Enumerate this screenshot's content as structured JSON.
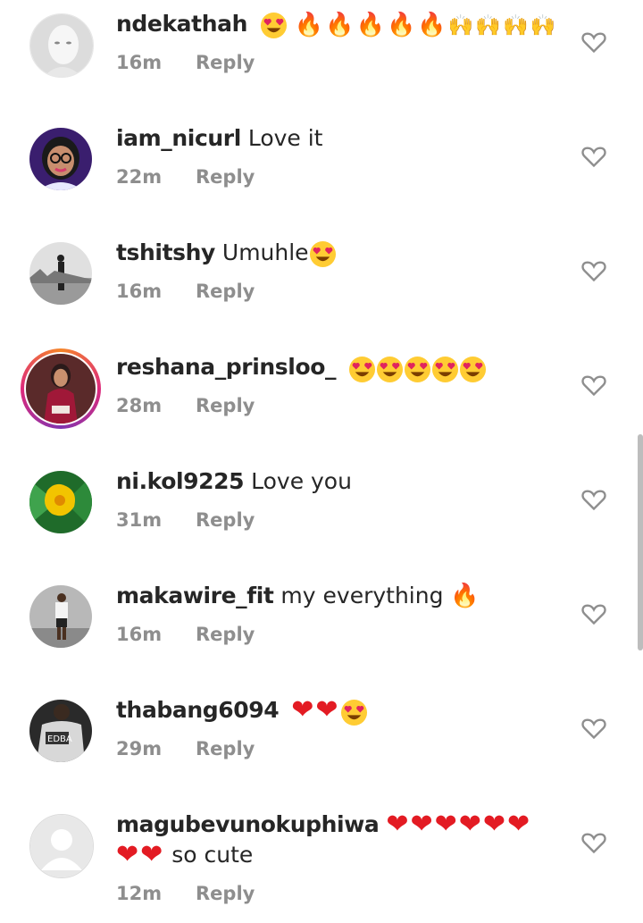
{
  "comments": [
    {
      "username": "ndekathah",
      "text": "",
      "time": "16m",
      "reply": "Reply",
      "emojis": [
        "love",
        "love-sep",
        "fire",
        "fire",
        "fire",
        "fire",
        "fire",
        "hands",
        "hands",
        "hands",
        "hands"
      ]
    },
    {
      "username": "iam_nicurl",
      "text": "Love it",
      "time": "22m",
      "reply": "Reply",
      "emojis": []
    },
    {
      "username": "tshitshy",
      "text": "Umuhle",
      "time": "16m",
      "reply": "Reply",
      "emojis": [
        "love"
      ]
    },
    {
      "username": "reshana_prinsloo_",
      "text": "",
      "time": "28m",
      "reply": "Reply",
      "emojis": [
        "love",
        "love",
        "love",
        "love",
        "love"
      ]
    },
    {
      "username": "ni.kol9225",
      "text": "Love you",
      "time": "31m",
      "reply": "Reply",
      "emojis": []
    },
    {
      "username": "makawire_fit",
      "text": "my everything",
      "time": "16m",
      "reply": "Reply",
      "emojis": [
        "fire"
      ]
    },
    {
      "username": "thabang6094",
      "text": "",
      "time": "29m",
      "reply": "Reply",
      "emojis": [
        "heart",
        "heart",
        "love"
      ]
    },
    {
      "username": "magubevunokuphiwa",
      "text": "so cute",
      "time": "12m",
      "reply": "Reply",
      "emojis": [
        "heart",
        "heart",
        "heart",
        "heart",
        "heart",
        "heart",
        "heart",
        "heart"
      ]
    }
  ],
  "icons": {
    "like": "heart-outline-icon"
  },
  "colors": {
    "secondary": "#8e8e8e",
    "text": "#262626",
    "heart": "#e31b23"
  }
}
